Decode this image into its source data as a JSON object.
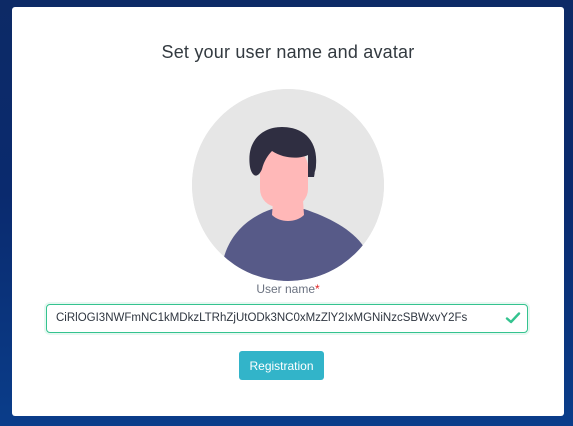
{
  "dialog": {
    "title": "Set your user name and avatar"
  },
  "avatar": {
    "icon": "user-avatar-illustration",
    "colors": {
      "background": "#e6e6e6",
      "hair": "#2f2e41",
      "skin": "#ffb8b8",
      "shirt": "#575a88"
    }
  },
  "username": {
    "label": "User name",
    "required_mark": "*",
    "value": "CiRlOGI3NWFmNC1kMDkzLTRhZjUtODk3NC0xMzZlY2IxMGNiNzcSBWxvY2Fs",
    "valid_icon": "check-icon"
  },
  "actions": {
    "register_label": "Registration"
  },
  "colors": {
    "page_background": "#0a2a6e",
    "accent_green": "#34c38f",
    "button": "#32b4c9"
  }
}
